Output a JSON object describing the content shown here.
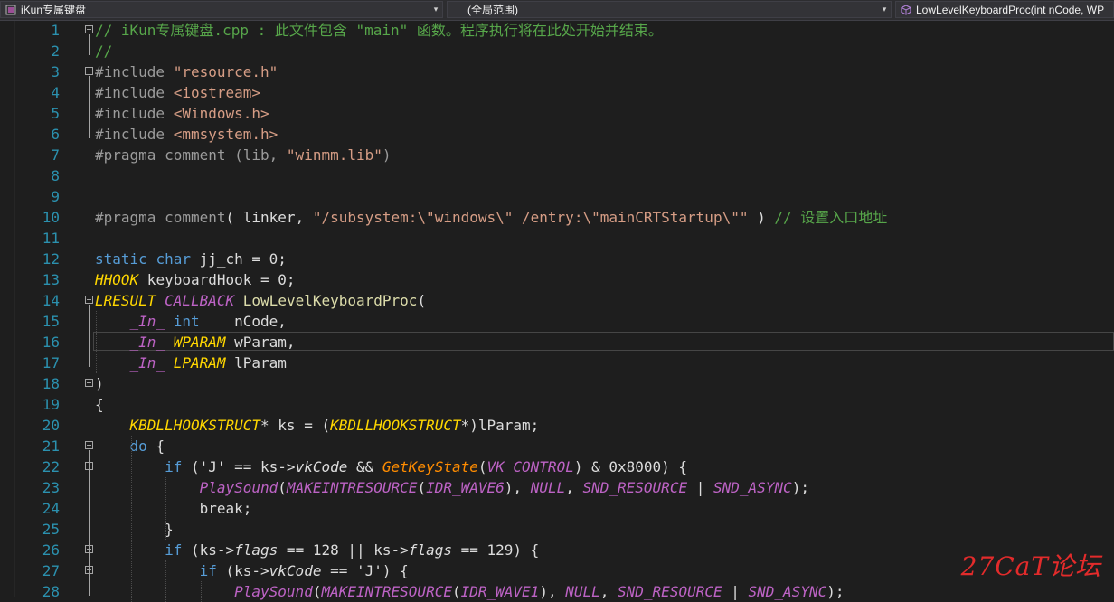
{
  "navbar": {
    "project": "iKun专属键盘",
    "scope": "(全局范围)",
    "member": "LowLevelKeyboardProc(int nCode, WP"
  },
  "editor": {
    "line_numbers": [
      "1",
      "2",
      "3",
      "4",
      "5",
      "6",
      "7",
      "8",
      "9",
      "10",
      "11",
      "12",
      "13",
      "14",
      "15",
      "16",
      "17",
      "18",
      "19",
      "20",
      "21",
      "22",
      "23",
      "24",
      "25",
      "26",
      "27",
      "28"
    ],
    "lines": [
      [
        {
          "t": "// iKun专属键盘.cpp : 此文件包含 \"main\" 函数。程序执行将在此处开始并结束。",
          "c": "cm"
        }
      ],
      [
        {
          "t": "//",
          "c": "cm"
        }
      ],
      [
        {
          "t": "#include ",
          "c": "pp"
        },
        {
          "t": "\"resource.h\"",
          "c": "st"
        }
      ],
      [
        {
          "t": "#include ",
          "c": "pp"
        },
        {
          "t": "<iostream>",
          "c": "st"
        }
      ],
      [
        {
          "t": "#include ",
          "c": "pp"
        },
        {
          "t": "<Windows.h>",
          "c": "st"
        }
      ],
      [
        {
          "t": "#include ",
          "c": "pp"
        },
        {
          "t": "<mmsystem.h>",
          "c": "st"
        }
      ],
      [
        {
          "t": "#pragma comment ",
          "c": "pp"
        },
        {
          "t": "(lib, ",
          "c": "pp"
        },
        {
          "t": "\"winmm.lib\"",
          "c": "st"
        },
        {
          "t": ")",
          "c": "pp"
        }
      ],
      [],
      [],
      [
        {
          "t": "#pragma comment",
          "c": "pp"
        },
        {
          "t": "( linker, ",
          "c": ""
        },
        {
          "t": "\"/subsystem:\\\"windows\\\" /entry:\\\"mainCRTStartup\\\"\"",
          "c": "st"
        },
        {
          "t": " ) ",
          "c": ""
        },
        {
          "t": "// 设置入口地址",
          "c": "cm"
        }
      ],
      [],
      [
        {
          "t": "static ",
          "c": "kw"
        },
        {
          "t": "char ",
          "c": "kw"
        },
        {
          "t": "jj_ch = 0;",
          "c": ""
        }
      ],
      [
        {
          "t": "HHOOK",
          "c": "yel"
        },
        {
          "t": " keyboardHook = 0;",
          "c": ""
        }
      ],
      [
        {
          "t": "LRESULT",
          "c": "yel"
        },
        {
          "t": " ",
          "c": ""
        },
        {
          "t": "CALLBACK",
          "c": "pur"
        },
        {
          "t": " ",
          "c": ""
        },
        {
          "t": "LowLevelKeyboardProc",
          "c": "fn"
        },
        {
          "t": "(",
          "c": ""
        }
      ],
      [
        {
          "t": "    ",
          "c": ""
        },
        {
          "t": "_In_",
          "c": "pur"
        },
        {
          "t": " ",
          "c": ""
        },
        {
          "t": "int",
          "c": "kw"
        },
        {
          "t": "    nCode,",
          "c": ""
        }
      ],
      [
        {
          "t": "    ",
          "c": ""
        },
        {
          "t": "_In_",
          "c": "pur"
        },
        {
          "t": " ",
          "c": ""
        },
        {
          "t": "WPARAM",
          "c": "yel"
        },
        {
          "t": " wParam,",
          "c": ""
        }
      ],
      [
        {
          "t": "    ",
          "c": ""
        },
        {
          "t": "_In_",
          "c": "pur"
        },
        {
          "t": " ",
          "c": ""
        },
        {
          "t": "LPARAM",
          "c": "yel"
        },
        {
          "t": " lParam",
          "c": ""
        }
      ],
      [
        {
          "t": ")",
          "c": ""
        }
      ],
      [
        {
          "t": "{",
          "c": ""
        }
      ],
      [
        {
          "t": "    ",
          "c": ""
        },
        {
          "t": "KBDLLHOOKSTRUCT",
          "c": "yel"
        },
        {
          "t": "* ks = (",
          "c": ""
        },
        {
          "t": "KBDLLHOOKSTRUCT",
          "c": "yel"
        },
        {
          "t": "*)lParam;",
          "c": ""
        }
      ],
      [
        {
          "t": "    ",
          "c": ""
        },
        {
          "t": "do",
          "c": "kw"
        },
        {
          "t": " {",
          "c": ""
        }
      ],
      [
        {
          "t": "        ",
          "c": ""
        },
        {
          "t": "if",
          "c": "kw"
        },
        {
          "t": " ('J' == ks->",
          "c": ""
        },
        {
          "t": "vkCode",
          "c": "em"
        },
        {
          "t": " && ",
          "c": ""
        },
        {
          "t": "GetKeyState",
          "c": "org"
        },
        {
          "t": "(",
          "c": ""
        },
        {
          "t": "VK_CONTROL",
          "c": "pur"
        },
        {
          "t": ") & 0x8000) {",
          "c": ""
        }
      ],
      [
        {
          "t": "            ",
          "c": ""
        },
        {
          "t": "PlaySound",
          "c": "pur"
        },
        {
          "t": "(",
          "c": ""
        },
        {
          "t": "MAKEINTRESOURCE",
          "c": "pur"
        },
        {
          "t": "(",
          "c": ""
        },
        {
          "t": "IDR_WAVE6",
          "c": "pur"
        },
        {
          "t": "), ",
          "c": ""
        },
        {
          "t": "NULL",
          "c": "pur"
        },
        {
          "t": ", ",
          "c": ""
        },
        {
          "t": "SND_RESOURCE",
          "c": "pur"
        },
        {
          "t": " | ",
          "c": ""
        },
        {
          "t": "SND_ASYNC",
          "c": "pur"
        },
        {
          "t": ");",
          "c": ""
        }
      ],
      [
        {
          "t": "            break;",
          "c": ""
        }
      ],
      [
        {
          "t": "        }",
          "c": ""
        }
      ],
      [
        {
          "t": "        ",
          "c": ""
        },
        {
          "t": "if",
          "c": "kw"
        },
        {
          "t": " (ks->",
          "c": ""
        },
        {
          "t": "flags",
          "c": "em"
        },
        {
          "t": " == 128 || ks->",
          "c": ""
        },
        {
          "t": "flags",
          "c": "em"
        },
        {
          "t": " == 129) {",
          "c": ""
        }
      ],
      [
        {
          "t": "            ",
          "c": ""
        },
        {
          "t": "if",
          "c": "kw"
        },
        {
          "t": " (ks->",
          "c": ""
        },
        {
          "t": "vkCode",
          "c": "em"
        },
        {
          "t": " == 'J') {",
          "c": ""
        }
      ],
      [
        {
          "t": "                ",
          "c": ""
        },
        {
          "t": "PlaySound",
          "c": "pur"
        },
        {
          "t": "(",
          "c": ""
        },
        {
          "t": "MAKEINTRESOURCE",
          "c": "pur"
        },
        {
          "t": "(",
          "c": ""
        },
        {
          "t": "IDR_WAVE1",
          "c": "pur"
        },
        {
          "t": "), ",
          "c": ""
        },
        {
          "t": "NULL",
          "c": "pur"
        },
        {
          "t": ", ",
          "c": ""
        },
        {
          "t": "SND_RESOURCE",
          "c": "pur"
        },
        {
          "t": " | ",
          "c": ""
        },
        {
          "t": "SND_ASYNC",
          "c": "pur"
        },
        {
          "t": ");",
          "c": ""
        }
      ]
    ]
  },
  "watermark": "27CaT论坛",
  "colors": {
    "comment": "#57a64a",
    "string": "#d69d85",
    "keyword": "#569cd6",
    "line_number": "#2b91af",
    "background": "#1e1e1e"
  }
}
